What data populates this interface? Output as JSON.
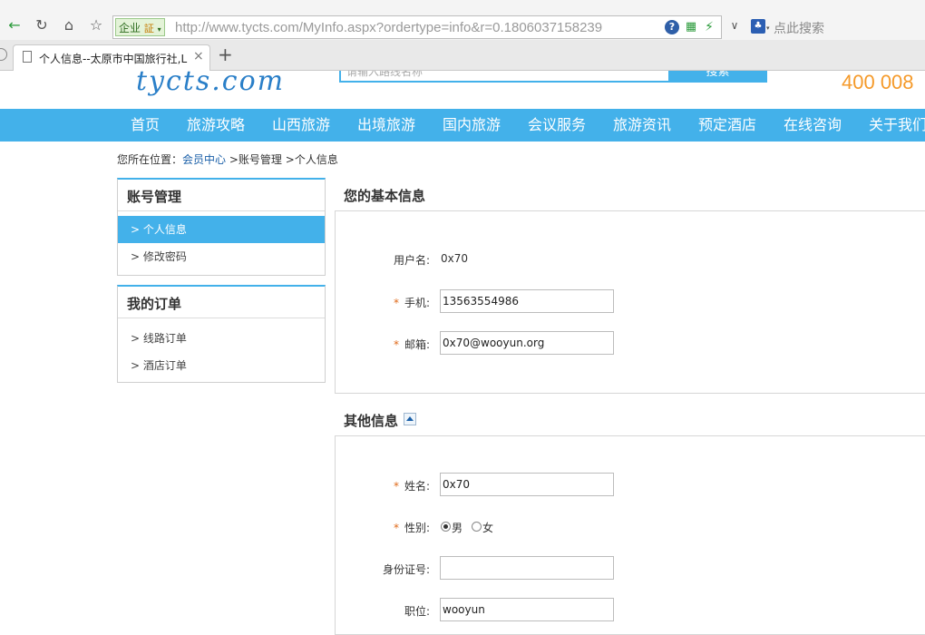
{
  "browser": {
    "address_badge": "企业",
    "badge_seal": "証",
    "url": "http://www.tycts.com/MyInfo.aspx?ordertype=info&r=0.1806037158239",
    "search_placeholder": "点此搜索",
    "tab_title": "个人信息--太原市中国旅行社,L",
    "new_tab": "+"
  },
  "header": {
    "logo": "tycts.com",
    "search_placeholder": "请输入路线名称",
    "search_button": "搜索",
    "hotline": "400 008"
  },
  "nav": {
    "items": [
      "首页",
      "旅游攻略",
      "山西旅游",
      "出境旅游",
      "国内旅游",
      "会议服务",
      "旅游资讯",
      "预定酒店",
      "在线咨询",
      "关于我们"
    ]
  },
  "breadcrumb": {
    "prefix": "您所在位置：",
    "member_center": "会员中心",
    "sep": ">",
    "account": "账号管理",
    "current": "个人信息"
  },
  "sidebar": {
    "account_title": "账号管理",
    "account_items": [
      {
        "label": "个人信息",
        "active": true
      },
      {
        "label": "修改密码",
        "active": false
      }
    ],
    "orders_title": "我的订单",
    "order_items": [
      {
        "label": "线路订单"
      },
      {
        "label": "酒店订单"
      }
    ]
  },
  "basic_info": {
    "title": "您的基本信息",
    "username_label": "用户名:",
    "username_value": "0x70",
    "phone_label": "手机:",
    "phone_value": "13563554986",
    "email_label": "邮箱:",
    "email_value": "0x70@wooyun.org"
  },
  "other_info": {
    "title": "其他信息",
    "name_label": "姓名:",
    "name_value": "0x70",
    "gender_label": "性别:",
    "gender_male": "男",
    "gender_female": "女",
    "gender_selected": "男",
    "id_label": "身份证号:",
    "id_value": "",
    "position_label": "职位:",
    "position_value": "wooyun"
  },
  "required_mark": "*",
  "colors": {
    "accent": "#43b1ea",
    "hotline": "#f59a2a",
    "required": "#e06a1a",
    "link": "#1a5fa8"
  }
}
